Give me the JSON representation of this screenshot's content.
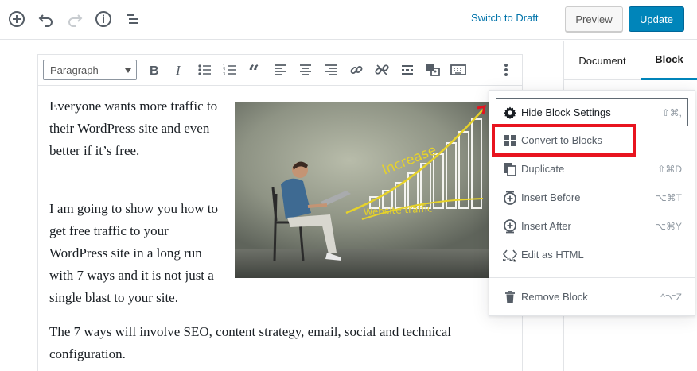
{
  "topbar": {
    "switch_draft": "Switch to Draft",
    "preview": "Preview",
    "update": "Update"
  },
  "sidebar": {
    "tabs": [
      {
        "label": "Document",
        "active": false
      },
      {
        "label": "Block",
        "active": true
      }
    ]
  },
  "toolbar": {
    "block_type": "Paragraph",
    "icons": [
      "bold-icon",
      "italic-icon",
      "bullet-list-icon",
      "numbered-list-icon",
      "quote-icon",
      "align-left-icon",
      "align-center-icon",
      "align-right-icon",
      "link-icon",
      "unlink-icon",
      "read-more-icon",
      "image-icon",
      "keyboard-icon",
      "more-options-icon"
    ]
  },
  "content": {
    "p1": "Everyone wants more traffic to their WordPress site and even better if it’s free.",
    "p2": "I am going to show you how to get free traffic to your WordPress site in a long run with 7 ways and it is not just a single blast to your site.",
    "p3": "The 7 ways will involve SEO, content strategy, email, social and technical configuration.",
    "image_text_1": "Increase",
    "image_text_2": "Website traffic"
  },
  "menu": {
    "hide": {
      "label": "Hide Block Settings",
      "shortcut": "⇧⌘,"
    },
    "convert": {
      "label": "Convert to Blocks"
    },
    "duplicate": {
      "label": "Duplicate",
      "shortcut": "⇧⌘D"
    },
    "insert_before": {
      "label": "Insert Before",
      "shortcut": "⌥⌘T"
    },
    "insert_after": {
      "label": "Insert After",
      "shortcut": "⌥⌘Y"
    },
    "edit_html": {
      "label": "Edit as HTML"
    },
    "remove": {
      "label": "Remove Block",
      "shortcut": "^⌥Z"
    }
  },
  "colors": {
    "primary": "#0085ba",
    "link": "#0073aa",
    "highlight": "#e8141f"
  }
}
